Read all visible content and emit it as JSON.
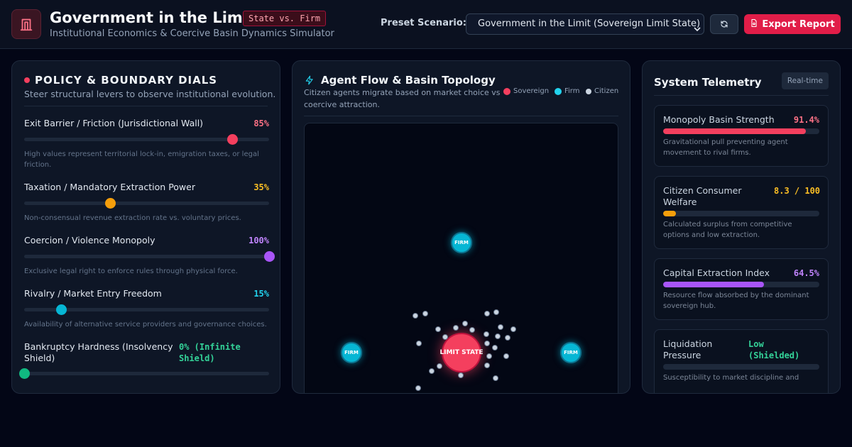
{
  "header": {
    "title": "Government in the Limit",
    "badge": "State vs. Firm",
    "subtitle": "Institutional Economics & Coercive Basin Dynamics Simulator",
    "preset_label": "Preset Scenario:",
    "preset_value": "Government in the Limit (Sovereign Limit State)",
    "export_label": "Export Report",
    "icons": [
      "building-icon",
      "chevron-down-icon",
      "refresh-icon",
      "file-export-icon"
    ]
  },
  "policy": {
    "title": "POLICY & BOUNDARY DIALS",
    "subtitle": "Steer structural levers to observe institutional evolution.",
    "sliders": [
      {
        "label": "Exit Barrier / Friction (Jurisdictional Wall)",
        "value_text": "85%",
        "level": 0.85,
        "color": "#f43f5e",
        "help": "High values represent territorial lock-in, emigration taxes, or legal friction."
      },
      {
        "label": "Taxation / Mandatory Extraction Power",
        "value_text": "35%",
        "level": 0.35,
        "color": "#f59e0b",
        "help": "Non-consensual revenue extraction rate vs. voluntary prices."
      },
      {
        "label": "Coercion / Violence Monopoly",
        "value_text": "100%",
        "level": 1.0,
        "color": "#a855f7",
        "help": "Exclusive legal right to enforce rules through physical force."
      },
      {
        "label": "Rivalry / Market Entry Freedom",
        "value_text": "15%",
        "level": 0.15,
        "color": "#06b6d4",
        "help": "Availability of alternative service providers and governance choices."
      },
      {
        "label": "Bankruptcy Hardness (Insolvency Shield)",
        "value_text": "0% (Infinite Shield)",
        "level": 0.0,
        "color": "#10b981",
        "help": ""
      }
    ]
  },
  "topology": {
    "title": "Agent Flow & Basin Topology",
    "subtitle": "Citizen agents migrate based on market choice vs coercive attraction.",
    "legend": [
      {
        "label": "Sovereign",
        "color": "#f43f5e"
      },
      {
        "label": "Firm",
        "color": "#22d3ee"
      },
      {
        "label": "Citizen",
        "color": "#cbd5e1"
      }
    ],
    "firm_label": "FIRM",
    "sovereign_label": "LIMIT STATE"
  },
  "telemetry": {
    "title": "System Telemetry",
    "badge": "Real-time",
    "cards": [
      {
        "label": "Monopoly Basin Strength",
        "value": "91.4%",
        "level": 0.914,
        "color": "#f43f5e",
        "desc": "Gravitational pull preventing agent movement to rival firms."
      },
      {
        "label": "Citizen Consumer Welfare",
        "value": "8.3 / 100",
        "level": 0.083,
        "color": "#f59e0b",
        "desc": "Calculated surplus from competitive options and low extraction."
      },
      {
        "label": "Capital Extraction Index",
        "value": "64.5%",
        "level": 0.645,
        "color": "#a855f7",
        "desc": "Resource flow absorbed by the dominant sovereign hub."
      },
      {
        "label": "Liquidation Pressure",
        "value": "Low (Shielded)",
        "level": 0.0,
        "color": "#10b981",
        "desc": "Susceptibility to market discipline and"
      }
    ]
  }
}
